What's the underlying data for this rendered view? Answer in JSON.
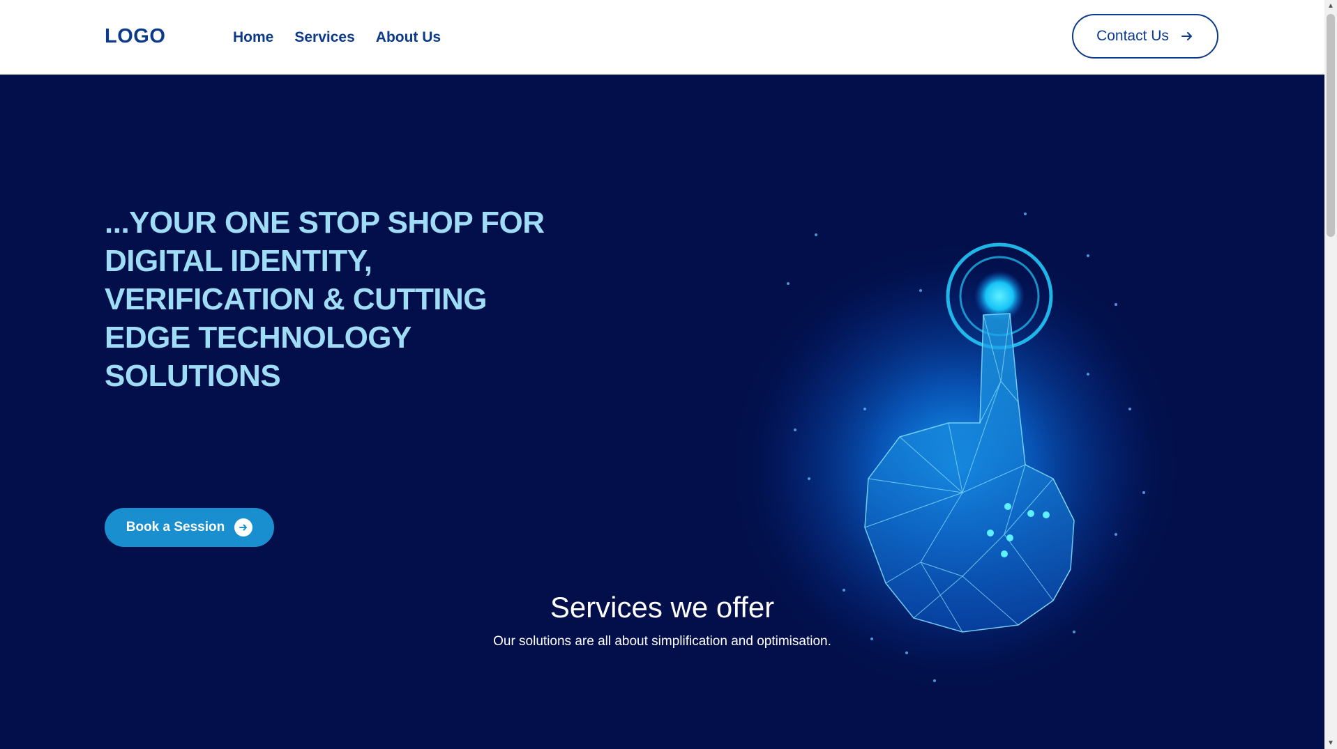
{
  "header": {
    "logo": "LOGO",
    "nav": [
      "Home",
      "Services",
      "About Us"
    ],
    "contact_label": "Contact Us"
  },
  "hero": {
    "headline": "...YOUR ONE STOP SHOP FOR DIGITAL IDENTITY, VERIFICATION & CUTTING EDGE TECHNOLOGY SOLUTIONS",
    "book_label": "Book a Session",
    "graphic_icon": "hand-touch-icon"
  },
  "services": {
    "title": "Services we offer",
    "subtitle": "Our solutions are all about simplification and optimisation."
  },
  "colors": {
    "brand": "#0b3a8a",
    "hero_bg": "#020f4a",
    "headline": "#9fdcf5",
    "accent": "#1a8fd0"
  }
}
